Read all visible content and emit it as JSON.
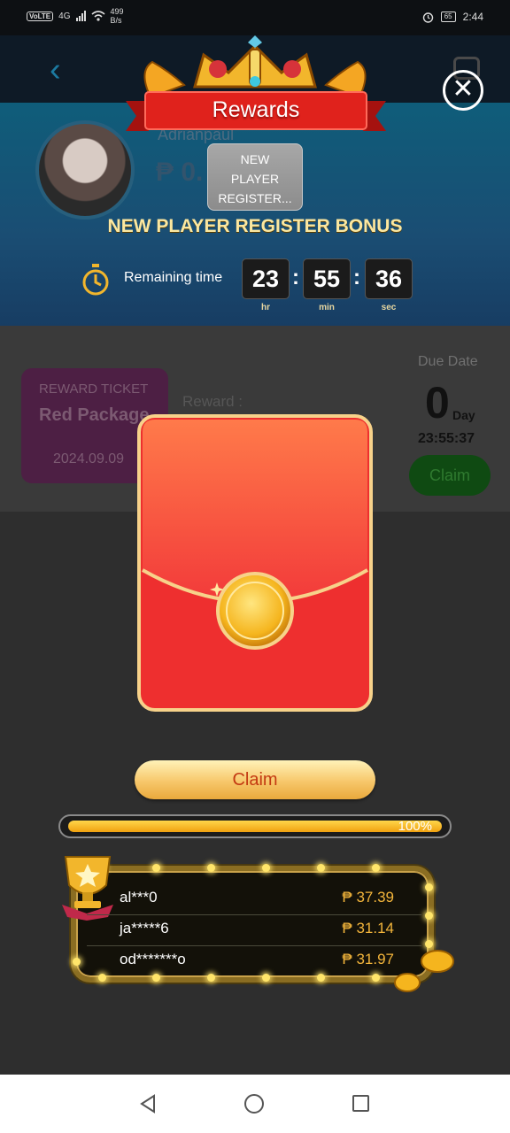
{
  "status_bar": {
    "volte": "VoLTE",
    "network": "4G",
    "speed_value": "499",
    "speed_unit": "B/s",
    "battery": "65",
    "time": "2:44"
  },
  "background_page": {
    "username": "Adrianpaul",
    "balance": "₱ 0.",
    "ticket_label": "REWARD TICKET",
    "ticket_title": "Red Package",
    "ticket_date": "2024.09.09",
    "reward_label": "Reward :",
    "due_date_label": "Due Date",
    "due_days": "0",
    "due_day_unit": "Day",
    "due_time": "23:55:37",
    "claim_label": "Claim"
  },
  "modal": {
    "title": "Rewards",
    "tooltip_lines": [
      "NEW",
      "PLAYER",
      "REGISTER..."
    ],
    "bonus_title": "NEW PLAYER REGISTER BONUS",
    "remaining_label": "Remaining time",
    "timer": {
      "hours": "23",
      "minutes": "55",
      "seconds": "36",
      "hours_unit": "hr",
      "minutes_unit": "min",
      "seconds_unit": "sec"
    },
    "claim_label": "Claim",
    "progress": {
      "value": 1.0,
      "text": "100%"
    },
    "winners": [
      {
        "name": "al***0",
        "amount": "₱ 37.39"
      },
      {
        "name": "ja*****6",
        "amount": "₱ 31.14"
      },
      {
        "name": "od*******o",
        "amount": "₱ 31.97"
      }
    ]
  },
  "colors": {
    "accent_gold": "#f3b53b",
    "banner_red": "#e0221c",
    "envelope_red": "#ee2f2f"
  }
}
